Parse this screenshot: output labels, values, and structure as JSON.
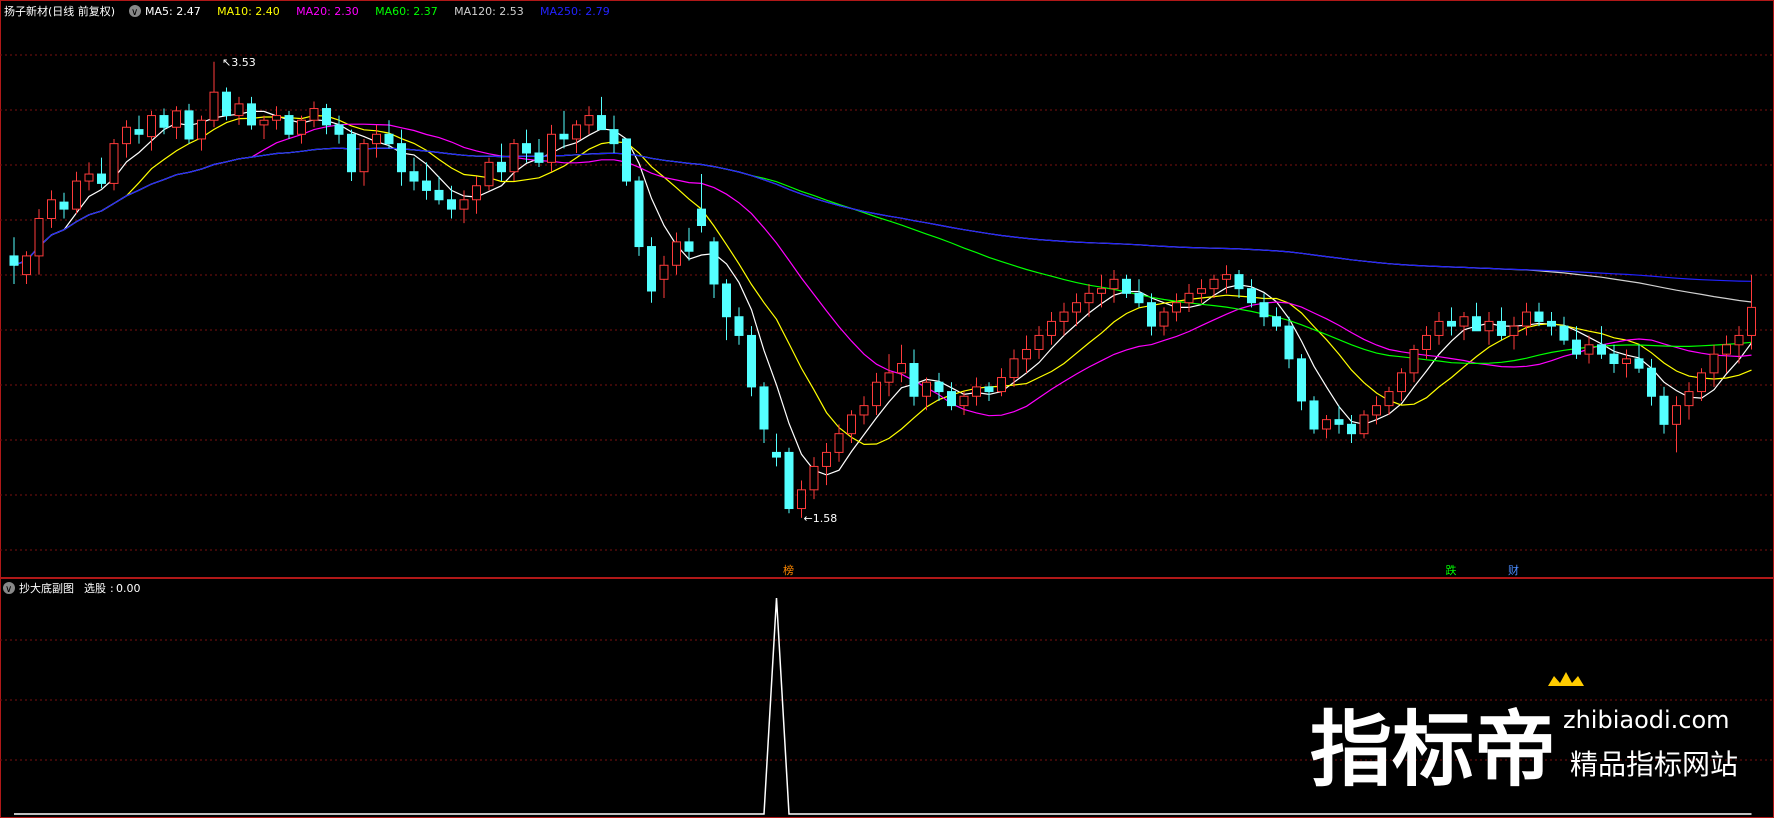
{
  "main_header": {
    "stock_title": "扬子新材(日线 前复权)",
    "indicators": [
      {
        "name": "MA5",
        "value": "2.47",
        "color": "#ffffff"
      },
      {
        "name": "MA10",
        "value": "2.40",
        "color": "#ffff00"
      },
      {
        "name": "MA20",
        "value": "2.30",
        "color": "#ff00ff"
      },
      {
        "name": "MA60",
        "value": "2.37",
        "color": "#00ff00"
      },
      {
        "name": "MA120",
        "value": "2.53",
        "color": "#d0d0d0"
      },
      {
        "name": "MA250",
        "value": "2.79",
        "color": "#2222ff"
      }
    ]
  },
  "sub_header": {
    "title": "抄大底副图",
    "indicator_name": "选股",
    "indicator_value": "0.00"
  },
  "watermark": {
    "logo": "指标帝",
    "domain": "zhibiaodi.com",
    "slogan": "精品指标网站"
  },
  "colors": {
    "up": "#ff3b3b",
    "down": "#54ffff",
    "grid": "#7a1010",
    "border": "#b01818",
    "signal": "#ffffff",
    "marker_text": "#ffffff"
  },
  "chart_data": [
    {
      "type": "candlestick",
      "title": "扬子新材(日线 前复权)",
      "ylim": [
        1.4,
        3.7
      ],
      "high_label": "3.53",
      "low_label": "1.58",
      "candles": [
        [
          2.7,
          2.78,
          2.58,
          2.66
        ],
        [
          2.62,
          2.72,
          2.58,
          2.7
        ],
        [
          2.7,
          2.9,
          2.62,
          2.86
        ],
        [
          2.86,
          2.98,
          2.82,
          2.94
        ],
        [
          2.93,
          2.97,
          2.86,
          2.9
        ],
        [
          2.9,
          3.06,
          2.88,
          3.02
        ],
        [
          3.02,
          3.1,
          2.98,
          3.05
        ],
        [
          3.05,
          3.12,
          2.99,
          3.01
        ],
        [
          3.01,
          3.2,
          2.98,
          3.18
        ],
        [
          3.18,
          3.28,
          3.12,
          3.25
        ],
        [
          3.24,
          3.3,
          3.18,
          3.22
        ],
        [
          3.21,
          3.32,
          3.15,
          3.3
        ],
        [
          3.3,
          3.33,
          3.22,
          3.25
        ],
        [
          3.25,
          3.34,
          3.2,
          3.32
        ],
        [
          3.32,
          3.35,
          3.18,
          3.2
        ],
        [
          3.2,
          3.3,
          3.15,
          3.28
        ],
        [
          3.28,
          3.53,
          3.25,
          3.4
        ],
        [
          3.4,
          3.42,
          3.28,
          3.3
        ],
        [
          3.3,
          3.38,
          3.26,
          3.35
        ],
        [
          3.35,
          3.38,
          3.24,
          3.26
        ],
        [
          3.26,
          3.3,
          3.2,
          3.28
        ],
        [
          3.28,
          3.34,
          3.24,
          3.3
        ],
        [
          3.3,
          3.32,
          3.2,
          3.22
        ],
        [
          3.22,
          3.3,
          3.18,
          3.28
        ],
        [
          3.28,
          3.36,
          3.25,
          3.33
        ],
        [
          3.33,
          3.35,
          3.22,
          3.26
        ],
        [
          3.26,
          3.3,
          3.18,
          3.22
        ],
        [
          3.22,
          3.24,
          3.02,
          3.06
        ],
        [
          3.06,
          3.2,
          3.0,
          3.18
        ],
        [
          3.18,
          3.26,
          3.12,
          3.22
        ],
        [
          3.22,
          3.28,
          3.16,
          3.18
        ],
        [
          3.18,
          3.24,
          3.0,
          3.06
        ],
        [
          3.06,
          3.12,
          2.98,
          3.02
        ],
        [
          3.02,
          3.1,
          2.94,
          2.98
        ],
        [
          2.98,
          3.04,
          2.92,
          2.94
        ],
        [
          2.94,
          3.0,
          2.86,
          2.9
        ],
        [
          2.9,
          2.98,
          2.84,
          2.94
        ],
        [
          2.94,
          3.04,
          2.88,
          3.0
        ],
        [
          3.0,
          3.12,
          2.98,
          3.1
        ],
        [
          3.1,
          3.18,
          3.02,
          3.06
        ],
        [
          3.06,
          3.2,
          3.02,
          3.18
        ],
        [
          3.18,
          3.24,
          3.1,
          3.14
        ],
        [
          3.14,
          3.2,
          3.08,
          3.1
        ],
        [
          3.1,
          3.26,
          3.06,
          3.22
        ],
        [
          3.22,
          3.32,
          3.16,
          3.2
        ],
        [
          3.2,
          3.28,
          3.14,
          3.26
        ],
        [
          3.26,
          3.34,
          3.22,
          3.3
        ],
        [
          3.3,
          3.38,
          3.25,
          3.24
        ],
        [
          3.24,
          3.3,
          3.14,
          3.18
        ],
        [
          3.2,
          3.2,
          3.0,
          3.02
        ],
        [
          3.02,
          3.04,
          2.7,
          2.74
        ],
        [
          2.74,
          2.78,
          2.5,
          2.55
        ],
        [
          2.6,
          2.7,
          2.52,
          2.66
        ],
        [
          2.66,
          2.8,
          2.62,
          2.76
        ],
        [
          2.76,
          2.82,
          2.68,
          2.72
        ],
        [
          2.9,
          3.05,
          2.8,
          2.83
        ],
        [
          2.76,
          2.78,
          2.52,
          2.58
        ],
        [
          2.58,
          2.6,
          2.34,
          2.44
        ],
        [
          2.44,
          2.48,
          2.32,
          2.36
        ],
        [
          2.36,
          2.4,
          2.1,
          2.14
        ],
        [
          2.14,
          2.16,
          1.9,
          1.96
        ],
        [
          1.86,
          1.94,
          1.8,
          1.84
        ],
        [
          1.86,
          1.88,
          1.6,
          1.62
        ],
        [
          1.62,
          1.74,
          1.58,
          1.7
        ],
        [
          1.7,
          1.84,
          1.66,
          1.8
        ],
        [
          1.8,
          1.9,
          1.72,
          1.86
        ],
        [
          1.86,
          1.98,
          1.82,
          1.94
        ],
        [
          1.94,
          2.04,
          1.9,
          2.02
        ],
        [
          2.02,
          2.1,
          1.98,
          2.06
        ],
        [
          2.06,
          2.2,
          2.02,
          2.16
        ],
        [
          2.16,
          2.28,
          2.1,
          2.2
        ],
        [
          2.2,
          2.32,
          2.16,
          2.24
        ],
        [
          2.24,
          2.3,
          2.06,
          2.1
        ],
        [
          2.1,
          2.18,
          2.04,
          2.16
        ],
        [
          2.16,
          2.2,
          2.08,
          2.12
        ],
        [
          2.12,
          2.16,
          2.04,
          2.06
        ],
        [
          2.06,
          2.12,
          2.02,
          2.1
        ],
        [
          2.1,
          2.18,
          2.06,
          2.14
        ],
        [
          2.14,
          2.16,
          2.08,
          2.12
        ],
        [
          2.12,
          2.22,
          2.1,
          2.18
        ],
        [
          2.18,
          2.3,
          2.14,
          2.26
        ],
        [
          2.26,
          2.36,
          2.2,
          2.3
        ],
        [
          2.3,
          2.4,
          2.26,
          2.36
        ],
        [
          2.36,
          2.46,
          2.32,
          2.42
        ],
        [
          2.42,
          2.5,
          2.36,
          2.46
        ],
        [
          2.46,
          2.54,
          2.4,
          2.5
        ],
        [
          2.5,
          2.58,
          2.44,
          2.54
        ],
        [
          2.54,
          2.62,
          2.48,
          2.56
        ],
        [
          2.56,
          2.64,
          2.5,
          2.6
        ],
        [
          2.6,
          2.62,
          2.52,
          2.54
        ],
        [
          2.54,
          2.6,
          2.48,
          2.5
        ],
        [
          2.5,
          2.54,
          2.36,
          2.4
        ],
        [
          2.4,
          2.48,
          2.36,
          2.46
        ],
        [
          2.46,
          2.54,
          2.42,
          2.5
        ],
        [
          2.5,
          2.58,
          2.46,
          2.54
        ],
        [
          2.54,
          2.6,
          2.5,
          2.56
        ],
        [
          2.56,
          2.62,
          2.52,
          2.6
        ],
        [
          2.6,
          2.66,
          2.54,
          2.62
        ],
        [
          2.62,
          2.64,
          2.52,
          2.56
        ],
        [
          2.56,
          2.6,
          2.48,
          2.5
        ],
        [
          2.5,
          2.54,
          2.4,
          2.44
        ],
        [
          2.44,
          2.48,
          2.38,
          2.4
        ],
        [
          2.4,
          2.44,
          2.22,
          2.26
        ],
        [
          2.26,
          2.28,
          2.04,
          2.08
        ],
        [
          2.08,
          2.1,
          1.94,
          1.96
        ],
        [
          1.96,
          2.02,
          1.92,
          2.0
        ],
        [
          2.0,
          2.06,
          1.94,
          1.98
        ],
        [
          1.98,
          2.02,
          1.9,
          1.94
        ],
        [
          1.94,
          2.04,
          1.92,
          2.02
        ],
        [
          2.02,
          2.1,
          1.98,
          2.06
        ],
        [
          2.06,
          2.14,
          2.02,
          2.12
        ],
        [
          2.12,
          2.22,
          2.08,
          2.2
        ],
        [
          2.2,
          2.32,
          2.16,
          2.3
        ],
        [
          2.3,
          2.4,
          2.26,
          2.36
        ],
        [
          2.36,
          2.46,
          2.32,
          2.42
        ],
        [
          2.42,
          2.48,
          2.36,
          2.4
        ],
        [
          2.4,
          2.46,
          2.34,
          2.44
        ],
        [
          2.44,
          2.5,
          2.38,
          2.38
        ],
        [
          2.38,
          2.46,
          2.32,
          2.42
        ],
        [
          2.42,
          2.48,
          2.34,
          2.36
        ],
        [
          2.36,
          2.44,
          2.3,
          2.4
        ],
        [
          2.4,
          2.5,
          2.36,
          2.46
        ],
        [
          2.46,
          2.5,
          2.4,
          2.42
        ],
        [
          2.42,
          2.46,
          2.36,
          2.4
        ],
        [
          2.4,
          2.44,
          2.32,
          2.34
        ],
        [
          2.34,
          2.4,
          2.26,
          2.28
        ],
        [
          2.28,
          2.36,
          2.24,
          2.32
        ],
        [
          2.32,
          2.4,
          2.26,
          2.28
        ],
        [
          2.28,
          2.32,
          2.2,
          2.24
        ],
        [
          2.24,
          2.3,
          2.18,
          2.26
        ],
        [
          2.26,
          2.32,
          2.2,
          2.22
        ],
        [
          2.22,
          2.26,
          2.06,
          2.1
        ],
        [
          2.1,
          2.14,
          1.94,
          1.98
        ],
        [
          1.98,
          2.1,
          1.86,
          2.06
        ],
        [
          2.06,
          2.16,
          2.0,
          2.12
        ],
        [
          2.12,
          2.22,
          2.08,
          2.2
        ],
        [
          2.2,
          2.32,
          2.14,
          2.28
        ],
        [
          2.28,
          2.36,
          2.2,
          2.32
        ],
        [
          2.32,
          2.4,
          2.24,
          2.36
        ],
        [
          2.36,
          2.62,
          2.3,
          2.48
        ]
      ]
    },
    {
      "type": "line",
      "title": "抄大底副图",
      "series": [
        {
          "name": "选股",
          "values": []
        }
      ],
      "ylim": [
        0,
        1
      ],
      "signal_index": 61
    }
  ],
  "event_markers": [
    {
      "index": 62,
      "label": "榜",
      "color": "#ff8800"
    },
    {
      "index": 115,
      "label": "跌",
      "color": "#00ff00"
    },
    {
      "index": 120,
      "label": "财",
      "color": "#4a8cff"
    }
  ]
}
